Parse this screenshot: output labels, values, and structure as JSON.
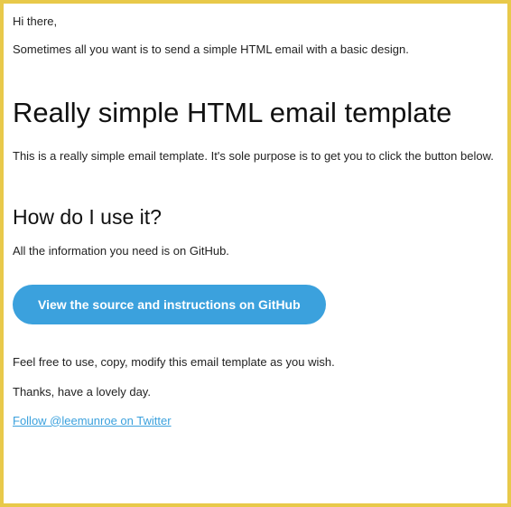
{
  "greeting": "Hi there,",
  "intro": "Sometimes all you want is to send a simple HTML email with a basic design.",
  "main_heading": "Really simple HTML email template",
  "desc": "This is a really simple email template. It's sole purpose is to get you to click the button below.",
  "sub_heading": "How do I use it?",
  "github_info": "All the information you need is on GitHub.",
  "cta_label": "View the source and instructions on GitHub",
  "free_use": "Feel free to use, copy, modify this email template as you wish.",
  "thanks": "Thanks, have a lovely day.",
  "twitter_link": "Follow @leemunroe on Twitter"
}
